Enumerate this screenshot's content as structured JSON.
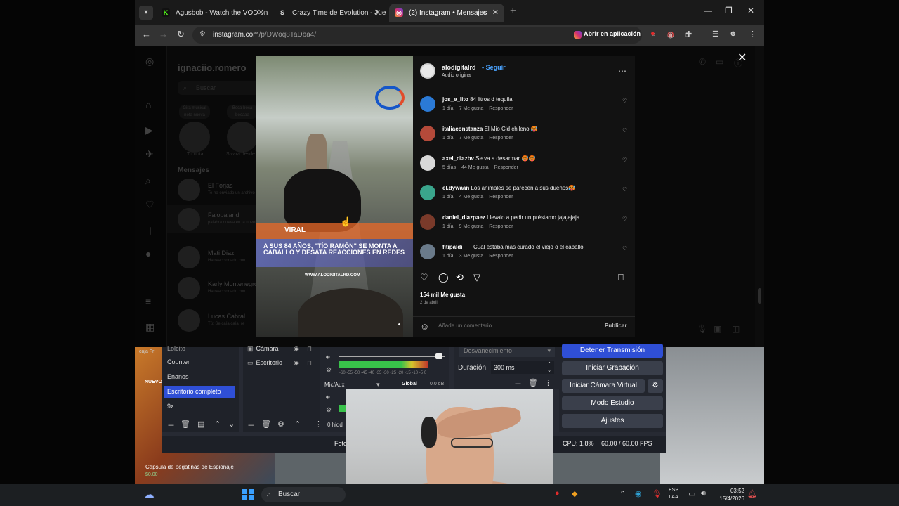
{
  "browser": {
    "tabs": [
      {
        "title": "Agusbob - Watch the VOD on K",
        "favicon": "kick-icon",
        "favicon_color": "#53fc18"
      },
      {
        "title": "Crazy Time de Evolution - Jueg",
        "favicon": "s-icon",
        "favicon_color": "#dddddd"
      },
      {
        "title": "(2) Instagram • Mensajes",
        "favicon": "instagram-icon",
        "favicon_color": "#d4306c"
      }
    ],
    "url_host": "instagram.com",
    "url_path": "/p/DWoq8TaDba4/",
    "open_in_app": "Abrir en aplicación"
  },
  "instagram": {
    "username": "ignaciio.romero",
    "search_placeholder": "Buscar",
    "notes": [
      {
        "bubble": "Gira musical nota nueva",
        "label": "Tu nota"
      },
      {
        "bubble": "Boca boca bocaaa",
        "label": "Sivara desde"
      }
    ],
    "messages_header": "Mensajes",
    "chats": [
      {
        "name": "El Forjas",
        "sub": "Te ha enviado un archivo"
      },
      {
        "name": "Falopaland",
        "sub": "palabra nueva en la novela"
      },
      {
        "name": "Mati Diaz",
        "sub": "Ha reaccionado con"
      },
      {
        "name": "Karly Montenegro",
        "sub": "Ha reaccionado con"
      },
      {
        "name": "Lucas Cabral",
        "sub": "Tú: Se caía caía, re"
      }
    ],
    "notification_count": "2"
  },
  "post": {
    "author": "alodigitalrd",
    "follow_label": "Seguir",
    "audio": "Audio original",
    "video": {
      "viral_tag": "VIRAL",
      "headline": "A SUS 84 AÑOS, \"TÍO RAMÓN\" SE MONTA A CABALLO Y DESATA REACCIONES EN REDES",
      "site": "WWW.ALODIGITALRD.COM",
      "logo": "ALO RD"
    },
    "comments": [
      {
        "user": "jos_e_lito",
        "text": "84 litros d tequila",
        "time": "1 día",
        "likes": "7 Me gusta",
        "reply": "Responder",
        "avatar_color": "#2b7ad6"
      },
      {
        "user": "italiaconstanza",
        "text": "El Mio Cid chileno 🥵",
        "time": "1 día",
        "likes": "7 Me gusta",
        "reply": "Responder",
        "avatar_color": "#b44a3a"
      },
      {
        "user": "axel_diazbv",
        "text": "Se va a desarmar 🥵🥵",
        "time": "5 días",
        "likes": "44 Me gusta",
        "reply": "Responder",
        "avatar_color": "#d8d8d8"
      },
      {
        "user": "el.dywaan",
        "text": "Los animales se parecen a sus dueños🥵",
        "time": "1 día",
        "likes": "4 Me gusta",
        "reply": "Responder",
        "avatar_color": "#3aa58c"
      },
      {
        "user": "daniel_diazpaez",
        "text": "Llevalo a pedir un préstamo jajajajaja",
        "time": "1 día",
        "likes": "9 Me gusta",
        "reply": "Responder",
        "avatar_color": "#7a3a2a"
      },
      {
        "user": "fitipaldi___",
        "text": "Cual estaba más curado el viejo o el caballo",
        "time": "1 día",
        "likes": "3 Me gusta",
        "reply": "Responder",
        "avatar_color": "#6a7a8a"
      }
    ],
    "likes_total": "154 mil Me gusta",
    "date": "2 de abril",
    "comment_placeholder": "Añade un comentario...",
    "publish_label": "Publicar"
  },
  "obs": {
    "scenes": [
      "Counter",
      "Enanos",
      "Escritorio completo",
      "9z"
    ],
    "scene_partial_top": "Lolcito",
    "selected_scene": "Escritorio completo",
    "sources": [
      "Cámara",
      "Escritorio"
    ],
    "mixer": {
      "ticks": "-60 -55 -50 -45 -40 -35 -30 -25 -20 -15 -10 -5 0",
      "channel": "Mic/Aux",
      "global_tag": "Global",
      "db": "0.0 dB"
    },
    "transition": {
      "name": "Desvanecimiento",
      "duration_label": "Duración",
      "duration_value": "300 ms"
    },
    "controls": [
      "Detener Transmisión",
      "Iniciar Grabación",
      "Iniciar Cámara Virtual",
      "Modo Estudio",
      "Ajustes"
    ],
    "hidden_label": "0 hidd",
    "status": {
      "cpu": "CPU: 1.8%",
      "fps": "60.00 / 60.00 FPS",
      "foto": "Foto"
    }
  },
  "desktop": {
    "caption": "Cápsula de pegatinas de Espionaje",
    "caption_price": "$0.00",
    "label_ff": "caja Fr",
    "label_nv": "NUEVOS"
  },
  "taskbar": {
    "search_label": "Buscar",
    "lang_top": "ESP",
    "lang_bottom": "LAA",
    "time": "03:52",
    "date": "15/4/2026"
  }
}
